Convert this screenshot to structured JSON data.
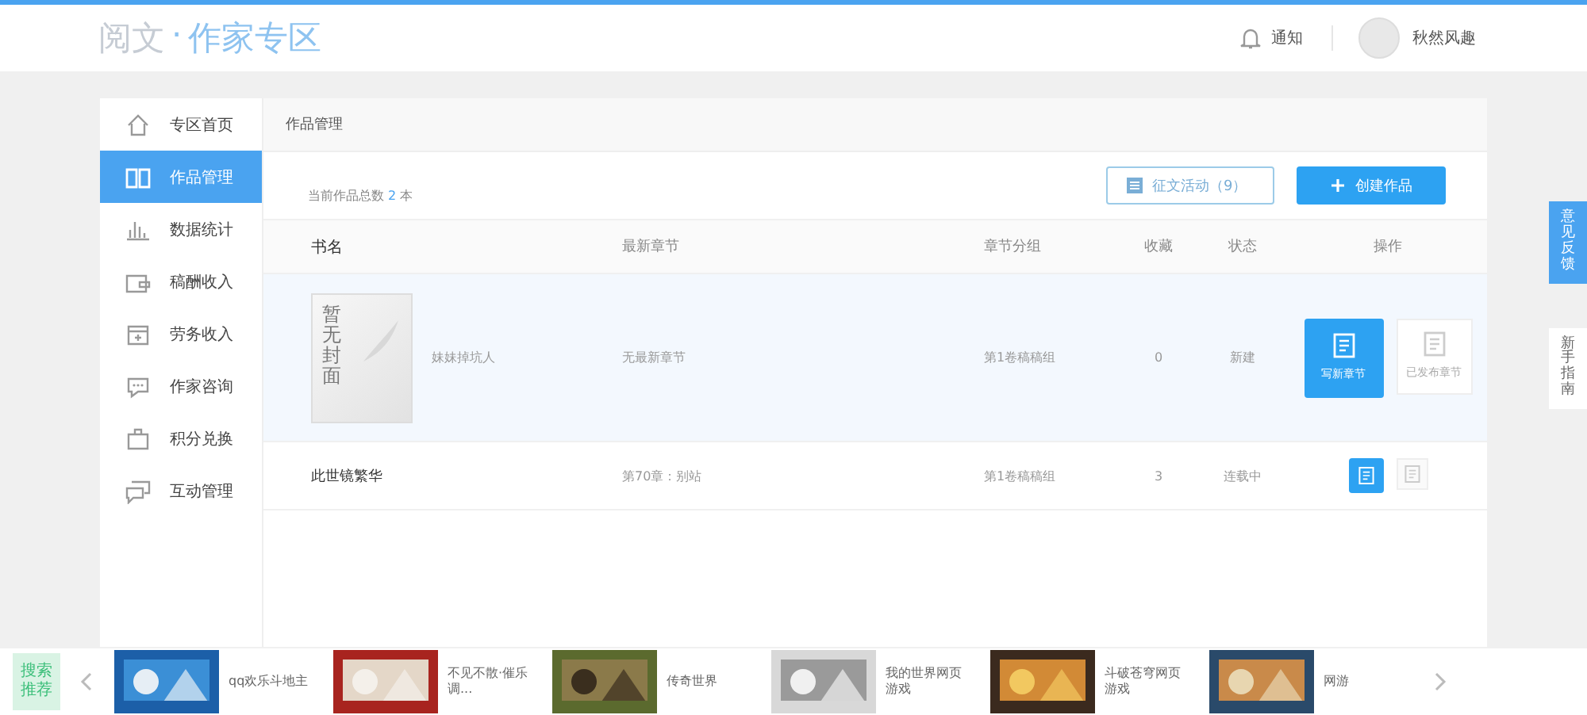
{
  "header": {
    "logo_left": "阅文",
    "logo_sep": "·",
    "logo_right": "作家专区",
    "notice": "通知",
    "username": "秋然风趣"
  },
  "sidebar": {
    "items": [
      {
        "label": "专区首页",
        "selected": false
      },
      {
        "label": "作品管理",
        "selected": true
      },
      {
        "label": "数据统计",
        "selected": false
      },
      {
        "label": "稿酬收入",
        "selected": false
      },
      {
        "label": "劳务收入",
        "selected": false
      },
      {
        "label": "作家咨询",
        "selected": false
      },
      {
        "label": "积分兑换",
        "selected": false
      },
      {
        "label": "互动管理",
        "selected": false
      }
    ]
  },
  "breadcrumb": "作品管理",
  "summary": {
    "label": "当前作品总数",
    "count": "2",
    "unit": "本"
  },
  "buttons": {
    "contest": "征文活动（9）",
    "create": "创建作品"
  },
  "table": {
    "columns": [
      "书名",
      "最新章节",
      "章节分组",
      "收藏",
      "状态",
      "操作"
    ],
    "rows": [
      {
        "cover": "暂无封面",
        "title": "妹妹掉坑人",
        "latest": "无最新章节",
        "group": "第1卷稿稿组",
        "favorites": "0",
        "status": "新建",
        "selected": true,
        "write": "写新章节",
        "published": "已发布章节"
      },
      {
        "title": "此世镜繁华",
        "latest": "第70章：别站",
        "group": "第1卷稿稿组",
        "favorites": "3",
        "status": "连载中",
        "selected": false
      }
    ]
  },
  "side_tabs": [
    {
      "label": "意见反馈",
      "selected": true
    },
    {
      "label": "新手指南",
      "selected": false
    }
  ],
  "recommend": {
    "title": "搜索推荐",
    "items": [
      {
        "caption": "qq欢乐斗地主",
        "kind": "picture"
      },
      {
        "caption": "不见不散·催乐调...",
        "kind": "picture"
      },
      {
        "caption": "传奇世界",
        "kind": "picture"
      },
      {
        "caption": "我的世界网页游戏",
        "kind": "picture"
      },
      {
        "caption": "斗破苍穹网页游戏",
        "kind": "picture"
      },
      {
        "caption": "网游",
        "kind": "picture"
      }
    ]
  }
}
